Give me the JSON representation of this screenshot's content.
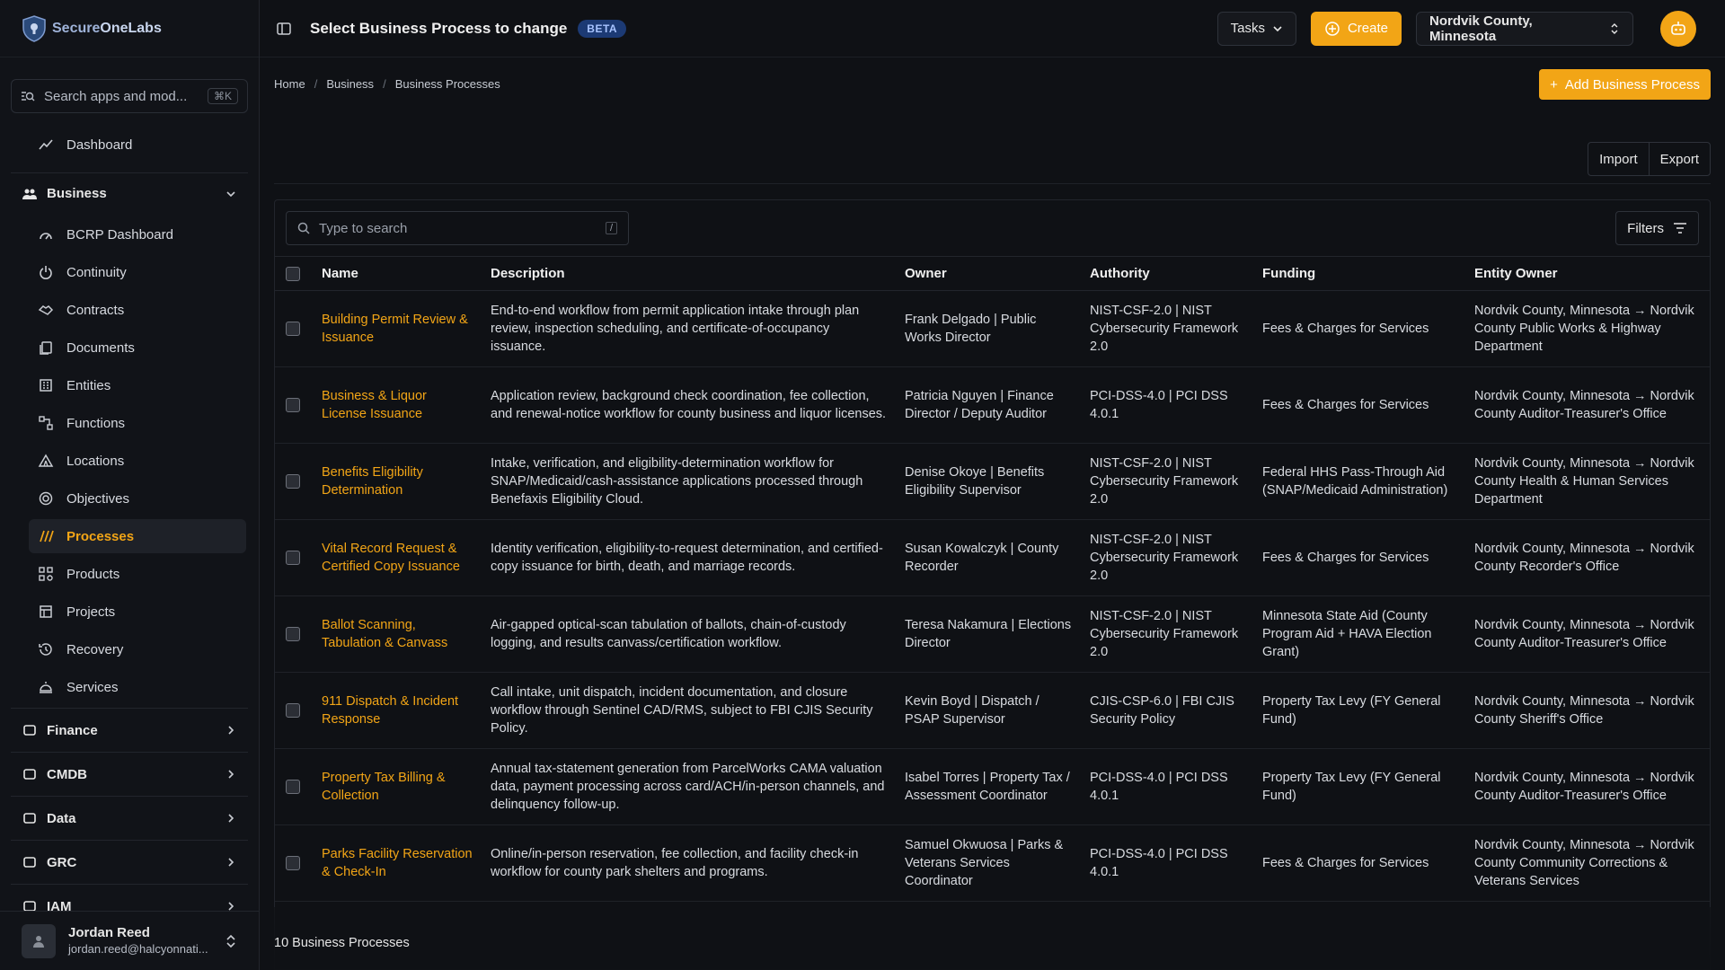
{
  "brand": {
    "name_a": "Secure",
    "name_b": "OneLabs"
  },
  "sidebar": {
    "search_placeholder": "Search apps and mod...",
    "search_kbd": "⌘K",
    "dashboard": "Dashboard",
    "business_group": "Business",
    "items": [
      {
        "label": "BCRP Dashboard",
        "icon": "gauge-icon"
      },
      {
        "label": "Continuity",
        "icon": "power-icon"
      },
      {
        "label": "Contracts",
        "icon": "handshake-icon"
      },
      {
        "label": "Documents",
        "icon": "documents-icon"
      },
      {
        "label": "Entities",
        "icon": "building-icon"
      },
      {
        "label": "Functions",
        "icon": "network-icon"
      },
      {
        "label": "Locations",
        "icon": "tent-icon"
      },
      {
        "label": "Objectives",
        "icon": "target-icon"
      },
      {
        "label": "Processes",
        "icon": "slashes-icon",
        "active": true
      },
      {
        "label": "Products",
        "icon": "products-icon"
      },
      {
        "label": "Projects",
        "icon": "projects-icon"
      },
      {
        "label": "Recovery",
        "icon": "history-icon"
      },
      {
        "label": "Services",
        "icon": "service-bell-icon"
      }
    ],
    "groups": [
      "Finance",
      "CMDB",
      "Data",
      "GRC",
      "IAM"
    ]
  },
  "user": {
    "name": "Jordan Reed",
    "email": "jordan.reed@halcyonnati..."
  },
  "topbar": {
    "title": "Select Business Process to change",
    "badge": "BETA",
    "tasks": "Tasks",
    "create": "Create",
    "org": "Nordvik County, Minnesota"
  },
  "breadcrumb": [
    "Home",
    "Business",
    "Business Processes"
  ],
  "add_button": "Add Business Process",
  "import": "Import",
  "export": "Export",
  "table_search_placeholder": "Type to search",
  "filters": "Filters",
  "columns": [
    "Name",
    "Description",
    "Owner",
    "Authority",
    "Funding",
    "Entity Owner"
  ],
  "rows": [
    {
      "name": "Building Permit Review & Issuance",
      "description": "End-to-end workflow from permit application intake through plan review, inspection scheduling, and certificate-of-occupancy issuance.",
      "owner": "Frank Delgado | Public Works Director",
      "authority": "NIST-CSF-2.0 | NIST Cybersecurity Framework 2.0",
      "funding": "Fees & Charges for Services",
      "entity": "Nordvik County, Minnesota → Nordvik County Public Works & Highway Department"
    },
    {
      "name": "Business & Liquor License Issuance",
      "description": "Application review, background check coordination, fee collection, and renewal-notice workflow for county business and liquor licenses.",
      "owner": "Patricia Nguyen | Finance Director / Deputy Auditor",
      "authority": "PCI-DSS-4.0 | PCI DSS 4.0.1",
      "funding": "Fees & Charges for Services",
      "entity": "Nordvik County, Minnesota → Nordvik County Auditor-Treasurer's Office"
    },
    {
      "name": "Benefits Eligibility Determination",
      "description": "Intake, verification, and eligibility-determination workflow for SNAP/Medicaid/cash-assistance applications processed through Benefaxis Eligibility Cloud.",
      "owner": "Denise Okoye | Benefits Eligibility Supervisor",
      "authority": "NIST-CSF-2.0 | NIST Cybersecurity Framework 2.0",
      "funding": "Federal HHS Pass-Through Aid (SNAP/Medicaid Administration)",
      "entity": "Nordvik County, Minnesota → Nordvik County Health & Human Services Department"
    },
    {
      "name": "Vital Record Request & Certified Copy Issuance",
      "description": "Identity verification, eligibility-to-request determination, and certified-copy issuance for birth, death, and marriage records.",
      "owner": "Susan Kowalczyk | County Recorder",
      "authority": "NIST-CSF-2.0 | NIST Cybersecurity Framework 2.0",
      "funding": "Fees & Charges for Services",
      "entity": "Nordvik County, Minnesota → Nordvik County Recorder's Office"
    },
    {
      "name": "Ballot Scanning, Tabulation & Canvass",
      "description": "Air-gapped optical-scan tabulation of ballots, chain-of-custody logging, and results canvass/certification workflow.",
      "owner": "Teresa Nakamura | Elections Director",
      "authority": "NIST-CSF-2.0 | NIST Cybersecurity Framework 2.0",
      "funding": "Minnesota State Aid (County Program Aid + HAVA Election Grant)",
      "entity": "Nordvik County, Minnesota → Nordvik County Auditor-Treasurer's Office"
    },
    {
      "name": "911 Dispatch & Incident Response",
      "description": "Call intake, unit dispatch, incident documentation, and closure workflow through Sentinel CAD/RMS, subject to FBI CJIS Security Policy.",
      "owner": "Kevin Boyd | Dispatch / PSAP Supervisor",
      "authority": "CJIS-CSP-6.0 | FBI CJIS Security Policy",
      "funding": "Property Tax Levy (FY General Fund)",
      "entity": "Nordvik County, Minnesota → Nordvik County Sheriff's Office"
    },
    {
      "name": "Property Tax Billing & Collection",
      "description": "Annual tax-statement generation from ParcelWorks CAMA valuation data, payment processing across card/ACH/in-person channels, and delinquency follow-up.",
      "owner": "Isabel Torres | Property Tax / Assessment Coordinator",
      "authority": "PCI-DSS-4.0 | PCI DSS 4.0.1",
      "funding": "Property Tax Levy (FY General Fund)",
      "entity": "Nordvik County, Minnesota → Nordvik County Auditor-Treasurer's Office"
    },
    {
      "name": "Parks Facility Reservation & Check-In",
      "description": "Online/in-person reservation, fee collection, and facility check-in workflow for county park shelters and programs.",
      "owner": "Samuel Okwuosa | Parks & Veterans Services Coordinator",
      "authority": "PCI-DSS-4.0 | PCI DSS 4.0.1",
      "funding": "Fees & Charges for Services",
      "entity": "Nordvik County, Minnesota → Nordvik County Community Corrections & Veterans Services"
    }
  ],
  "footer_count": "10 Business Processes",
  "colors": {
    "accent": "#f2a516",
    "bg": "#0f1115",
    "badge": "#1c3a74"
  }
}
